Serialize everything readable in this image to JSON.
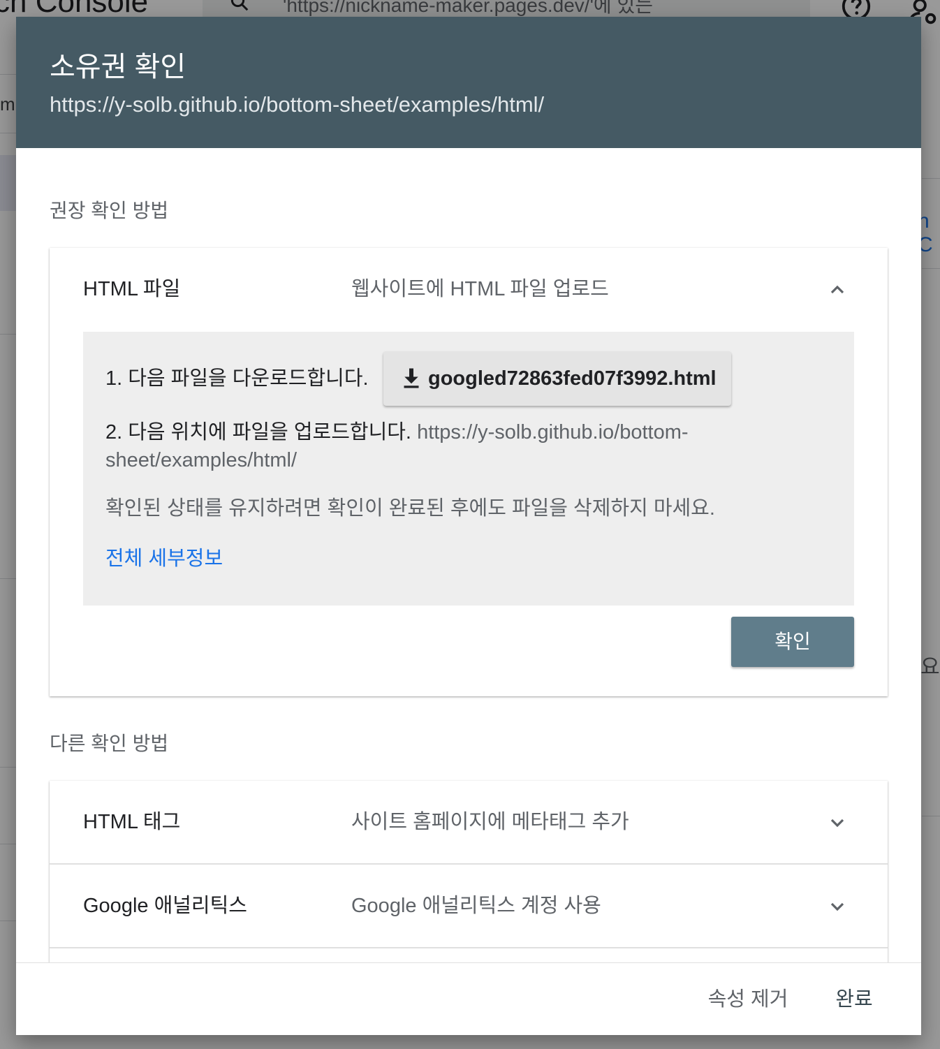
{
  "background": {
    "brand_fragment": "ch Console",
    "search_text": "'https://nickname-maker.pages.dev/'에 있는",
    "sidebar_fragment": "m.",
    "right_fragment_1": "n C",
    "right_fragment_2": "요"
  },
  "dialog": {
    "title": "소유권 확인",
    "url": "https://y-solb.github.io/bottom-sheet/examples/html/"
  },
  "recommended": {
    "section_label": "권장 확인 방법",
    "method": {
      "name": "HTML 파일",
      "description": "웹사이트에 HTML 파일 업로드",
      "expanded": true,
      "steps": {
        "step1_text": "1. 다음 파일을 다운로드합니다.",
        "download_file": "googled72863fed07f3992.html",
        "step2_text": "2. 다음 위치에 파일을 업로드합니다.",
        "step2_url": "https://y-solb.github.io/bottom-sheet/examples/html/",
        "keep_note": "확인된 상태를 유지하려면 확인이 완료된 후에도 파일을 삭제하지 마세요.",
        "details_link": "전체 세부정보"
      },
      "confirm_label": "확인"
    }
  },
  "other": {
    "section_label": "다른 확인 방법",
    "methods": [
      {
        "name": "HTML 태그",
        "description": "사이트 홈페이지에 메타태그 추가"
      },
      {
        "name": "Google 애널리틱스",
        "description": "Google 애널리틱스 계정 사용"
      }
    ]
  },
  "footer": {
    "remove_label": "속성 제거",
    "done_label": "완료"
  },
  "colors": {
    "header": "#455a64",
    "panel": "#eeeeee",
    "confirm_button": "#607d8b",
    "link": "#1a73e8"
  },
  "icons": {
    "download": "download-icon",
    "expand_less": "chevron-up-icon",
    "expand_more": "chevron-down-icon",
    "search": "search-icon",
    "help": "help-icon",
    "account": "account-settings-icon"
  }
}
